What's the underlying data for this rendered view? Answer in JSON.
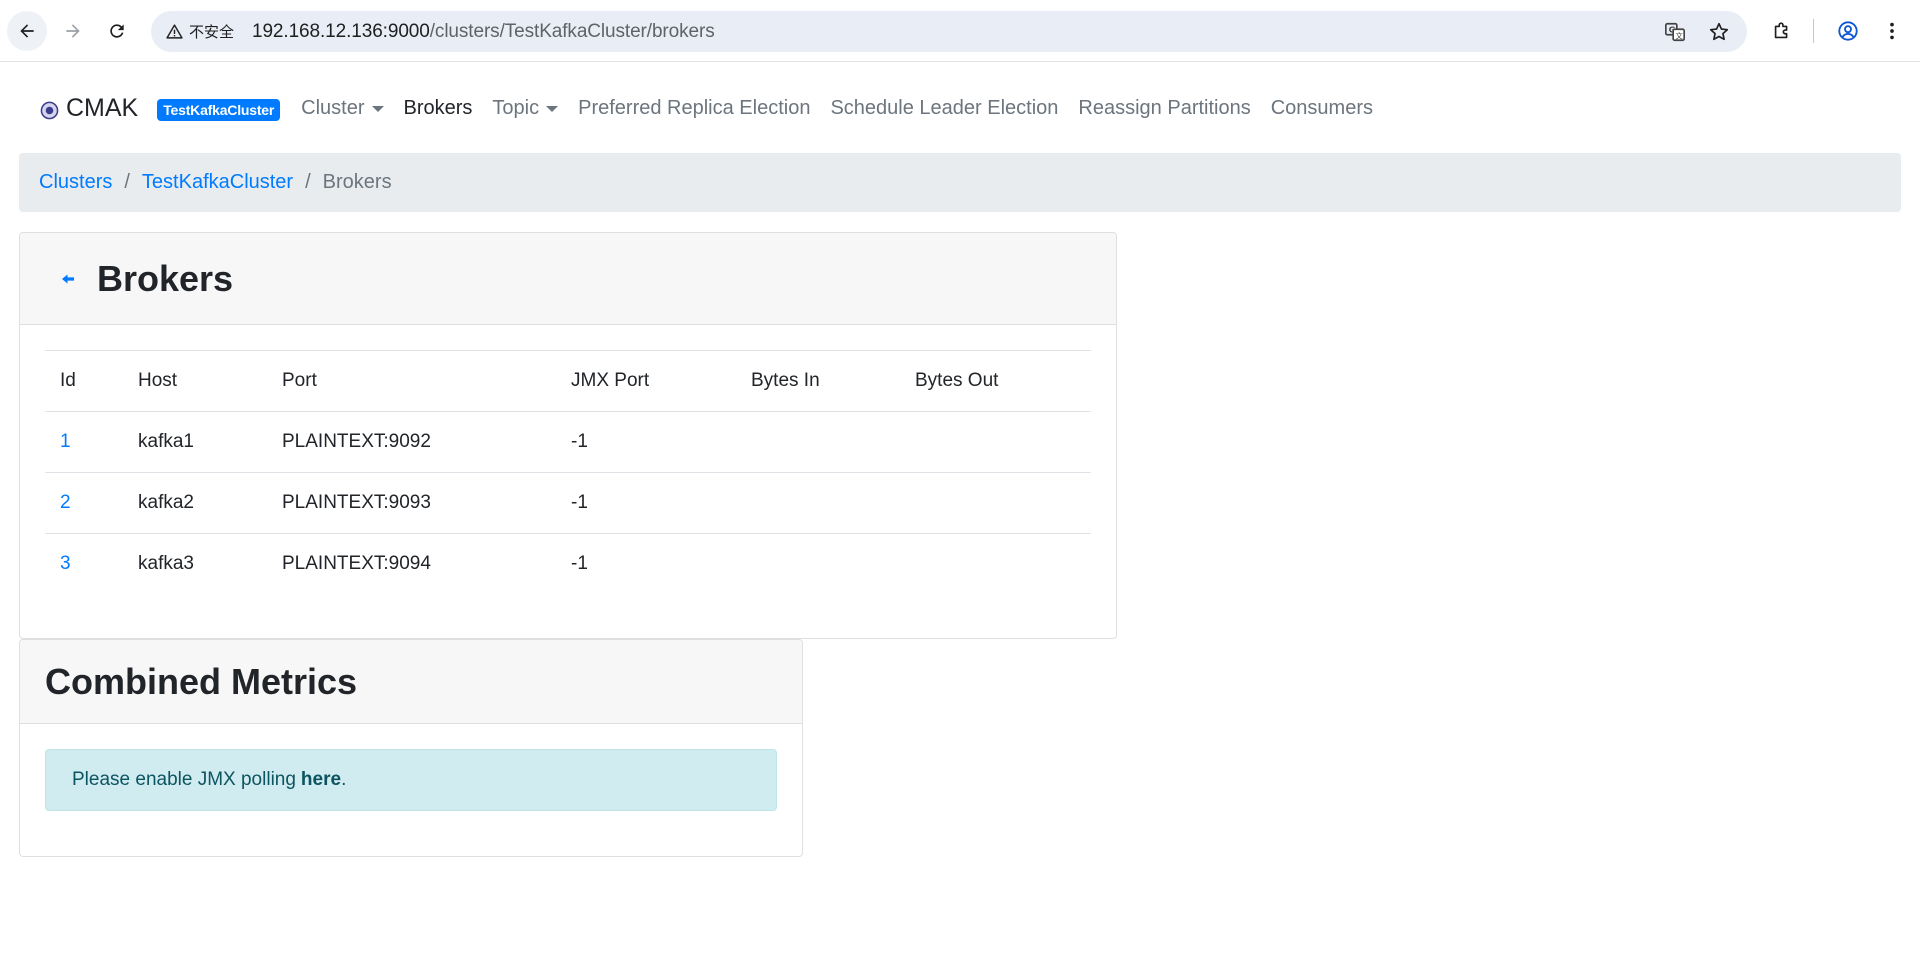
{
  "browser": {
    "security_label": "不安全",
    "url_host": "192.168.12.136:9000",
    "url_path": "/clusters/TestKafkaCluster/brokers"
  },
  "navbar": {
    "brand": "CMAK",
    "cluster_badge": "TestKafkaCluster",
    "items": [
      {
        "label": "Cluster"
      },
      {
        "label": "Brokers"
      },
      {
        "label": "Topic"
      },
      {
        "label": "Preferred Replica Election"
      },
      {
        "label": "Schedule Leader Election"
      },
      {
        "label": "Reassign Partitions"
      },
      {
        "label": "Consumers"
      }
    ]
  },
  "breadcrumb": {
    "items": [
      "Clusters",
      "TestKafkaCluster"
    ],
    "separator": "/",
    "current": "Brokers"
  },
  "brokers": {
    "title": "Brokers",
    "columns": [
      "Id",
      "Host",
      "Port",
      "JMX Port",
      "Bytes In",
      "Bytes Out"
    ],
    "rows": [
      {
        "id": "1",
        "host": "kafka1",
        "port": "PLAINTEXT:9092",
        "jmx_port": "-1",
        "bytes_in": "",
        "bytes_out": ""
      },
      {
        "id": "2",
        "host": "kafka2",
        "port": "PLAINTEXT:9093",
        "jmx_port": "-1",
        "bytes_in": "",
        "bytes_out": ""
      },
      {
        "id": "3",
        "host": "kafka3",
        "port": "PLAINTEXT:9094",
        "jmx_port": "-1",
        "bytes_in": "",
        "bytes_out": ""
      }
    ]
  },
  "metrics": {
    "title": "Combined Metrics",
    "alert_text": "Please enable JMX polling",
    "alert_link": "here",
    "alert_suffix": "."
  },
  "colors": {
    "link": "#007bff",
    "badge_bg": "#007bff",
    "alert_bg": "#d1ecf1",
    "alert_text": "#0c5460"
  }
}
